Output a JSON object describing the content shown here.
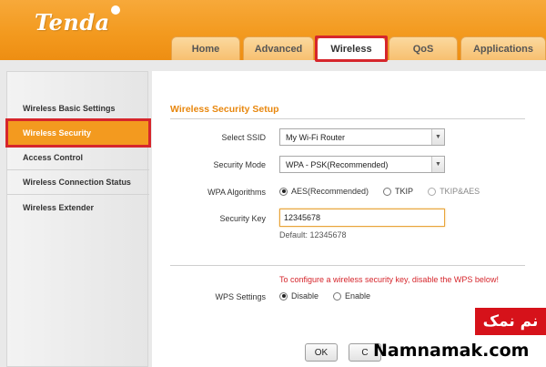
{
  "brand": {
    "logo": "Tenda"
  },
  "tabs": [
    {
      "label": "Home"
    },
    {
      "label": "Advanced"
    },
    {
      "label": "Wireless"
    },
    {
      "label": "QoS"
    },
    {
      "label": "Applications"
    }
  ],
  "active_tab": "Wireless",
  "sidebar": {
    "items": [
      {
        "label": "Wireless Basic Settings"
      },
      {
        "label": "Wireless Security"
      },
      {
        "label": "Access Control"
      },
      {
        "label": "Wireless Connection Status"
      },
      {
        "label": "Wireless Extender"
      }
    ],
    "active_item": "Wireless Security"
  },
  "form": {
    "title": "Wireless Security Setup",
    "ssid_label": "Select SSID",
    "ssid_value": "My Wi-Fi Router",
    "mode_label": "Security Mode",
    "mode_value": "WPA - PSK(Recommended)",
    "algo_label": "WPA Algorithms",
    "algo_options": [
      {
        "label": "AES(Recommended)",
        "selected": true
      },
      {
        "label": "TKIP",
        "selected": false
      },
      {
        "label": "TKIP&AES",
        "selected": false
      }
    ],
    "key_label": "Security Key",
    "key_value": "12345678",
    "key_default": "Default: 12345678",
    "wps_warning": "To configure a wireless security key, disable the WPS below!",
    "wps_label": "WPS Settings",
    "wps_options": [
      {
        "label": "Disable",
        "selected": true
      },
      {
        "label": "Enable",
        "selected": false
      }
    ],
    "ok_label": "OK",
    "cancel_label": "C"
  },
  "watermark": {
    "badge": "نم نمک",
    "site": "Namnamak.com"
  },
  "colors": {
    "orange": "#f39a1f",
    "highlight_red": "#d6262c",
    "title_orange": "#e8870e"
  }
}
